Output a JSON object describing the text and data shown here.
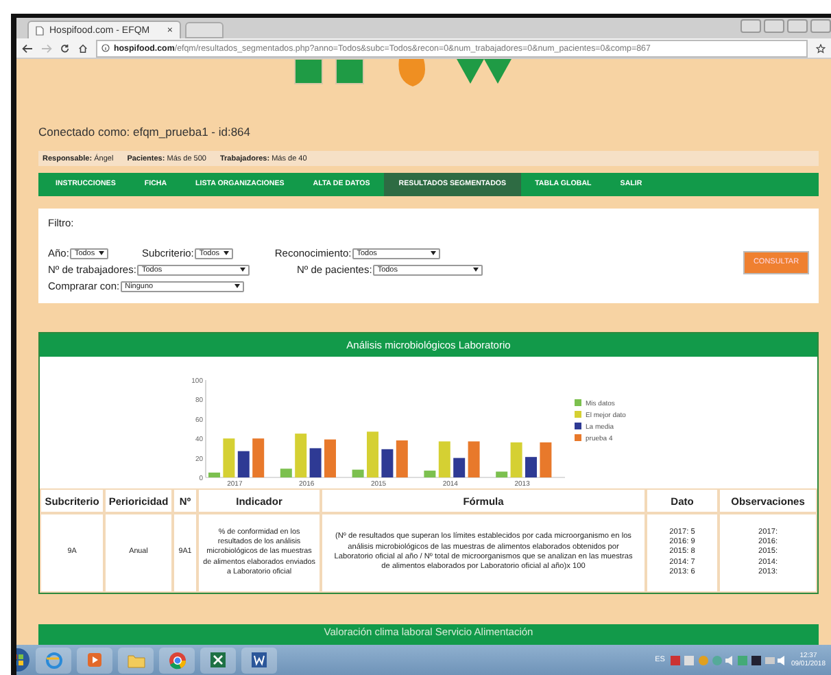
{
  "browser": {
    "tab_title": "Hospifood.com - EFQM",
    "tab_close": "×",
    "url_host": "hospifood.com",
    "url_path": "/efqm/resultados_segmentados.php?anno=Todos&subc=Todos&recon=0&num_trabajadores=0&num_pacientes=0&comp=867"
  },
  "user_line": "Conectado como: efqm_prueba1 - id:864",
  "info": [
    {
      "label": "Responsable:",
      "value": "Ángel"
    },
    {
      "label": "Pacientes:",
      "value": "Más de 500"
    },
    {
      "label": "Trabajadores:",
      "value": "Más de 40"
    }
  ],
  "nav": [
    {
      "label": "INSTRUCCIONES",
      "selected": false
    },
    {
      "label": "FICHA",
      "selected": false
    },
    {
      "label": "LISTA ORGANIZACIONES",
      "selected": false
    },
    {
      "label": "ALTA DE DATOS",
      "selected": false
    },
    {
      "label": "RESULTADOS SEGMENTADOS",
      "selected": true
    },
    {
      "label": "TABLA GLOBAL",
      "selected": false
    },
    {
      "label": "SALIR",
      "selected": false
    }
  ],
  "filter": {
    "title": "Filtro:",
    "fields": [
      {
        "label": "Año:",
        "value": "Todos"
      },
      {
        "label": "Subcriterio:",
        "value": "Todos"
      },
      {
        "label": "Reconocimiento:",
        "value": "Todos"
      },
      {
        "label": "Nº de trabajadores:",
        "value": "Todos"
      },
      {
        "label": "Nº de pacientes:",
        "value": "Todos"
      },
      {
        "label": "Comprarar con:",
        "value": "Ninguno"
      }
    ],
    "button": "CONSULTAR"
  },
  "section": {
    "title": "Análisis microbiológicos Laboratorio",
    "chart_data": {
      "type": "bar",
      "legend": true,
      "categories": [
        "2017",
        "2016",
        "2015",
        "2014",
        "2013"
      ],
      "ylim": [
        0,
        100
      ],
      "yticks": [
        0,
        20,
        40,
        60,
        80,
        100
      ],
      "series": [
        {
          "name": "Mis datos",
          "color": "#7cc04f",
          "values": [
            5,
            9,
            8,
            7,
            6
          ]
        },
        {
          "name": "El mejor dato",
          "color": "#d5d033",
          "values": [
            40,
            45,
            47,
            37,
            36
          ]
        },
        {
          "name": "La media",
          "color": "#2e3a94",
          "values": [
            27,
            30,
            29,
            20,
            21
          ]
        },
        {
          "name": "prueba 4",
          "color": "#e8792b",
          "values": [
            40,
            39,
            38,
            37,
            36
          ]
        }
      ]
    },
    "table": {
      "columns": [
        "Subcriterio",
        "Perioricidad",
        "Nº",
        "Indicador",
        "Fórmula",
        "Dato",
        "Observaciones"
      ],
      "rows": [
        {
          "subcriterio": "9A",
          "periodicidad": "Anual",
          "numero": "9A1",
          "indicador": "% de conformidad en los resultados de los análisis microbiológicos de las muestras de alimentos elaborados enviados a Laboratorio oficial",
          "formula": "(Nº de resultados que superan los límites establecidos por cada microorganismo en los análisis microbiológicos de las muestras de alimentos elaborados obtenidos por Laboratorio oficial al año / Nº total de microorganismos que se analizan en las muestras de alimentos elaborados por Laboratorio oficial al año)x 100",
          "dato": [
            "2017: 5",
            "2016: 9",
            "2015: 8",
            "2014: 7",
            "2013: 6"
          ],
          "observaciones": [
            "2017:",
            "2016:",
            "2015:",
            "2014:",
            "2013:"
          ]
        }
      ]
    }
  },
  "next_section": {
    "title": "Valoración clima laboral Servicio Alimentación"
  },
  "taskbar": {
    "language": "ES",
    "time": "12:37",
    "date": "09/01/2018"
  }
}
